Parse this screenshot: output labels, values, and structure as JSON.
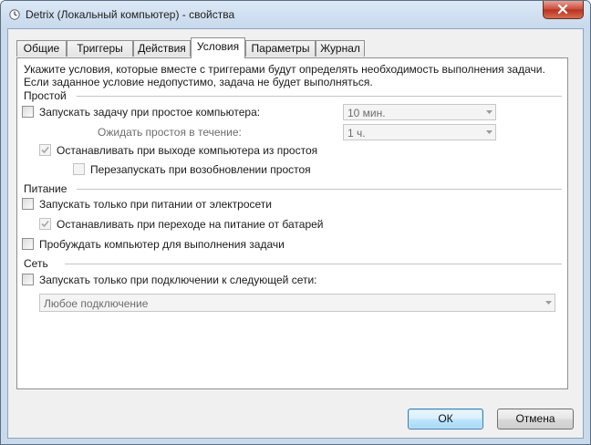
{
  "window": {
    "title": "Detrix (Локальный компьютер) - свойства",
    "icon": "clock-icon",
    "close_icon": "close-icon"
  },
  "tabs": [
    {
      "label": "Общие",
      "active": false
    },
    {
      "label": "Триггеры",
      "active": false
    },
    {
      "label": "Действия",
      "active": false
    },
    {
      "label": "Условия",
      "active": true
    },
    {
      "label": "Параметры",
      "active": false
    },
    {
      "label": "Журнал",
      "active": false
    }
  ],
  "conditions": {
    "intro_line1": "Укажите условия, которые вместе с триггерами будут определять необходимость выполнения задачи.",
    "intro_line2": "Если заданное условие недопустимо, задача не будет выполняться.",
    "idle": {
      "group_label": "Простой",
      "start_if_idle": {
        "label": "Запускать задачу при простое компьютера:",
        "checked": false
      },
      "idle_duration": {
        "value": "10 мин."
      },
      "wait_label": "Ожидать простоя в течение:",
      "wait_duration": {
        "value": "1 ч."
      },
      "stop_on_idle_end": {
        "label": "Останавливать при выходе компьютера из простоя",
        "checked": true,
        "enabled": false
      },
      "restart_on_idle_resume": {
        "label": "Перезапускать при возобновлении простоя",
        "checked": false,
        "enabled": false
      }
    },
    "power": {
      "group_label": "Питание",
      "ac_only": {
        "label": "Запускать только при питании от электросети",
        "checked": false
      },
      "stop_on_battery": {
        "label": "Останавливать при переходе на питание от батарей",
        "checked": true,
        "enabled": false
      },
      "wake_to_run": {
        "label": "Пробуждать компьютер для выполнения задачи",
        "checked": false
      }
    },
    "network": {
      "group_label": "Сеть",
      "network_only": {
        "label": "Запускать только при подключении к следующей сети:",
        "checked": false
      },
      "network_select": {
        "value": "Любое подключение"
      }
    }
  },
  "buttons": {
    "ok": "ОК",
    "cancel": "Отмена"
  },
  "colors": {
    "window_frame": "#c9daec",
    "close_button": "#c8493a",
    "default_button": "#3c7fb1"
  }
}
